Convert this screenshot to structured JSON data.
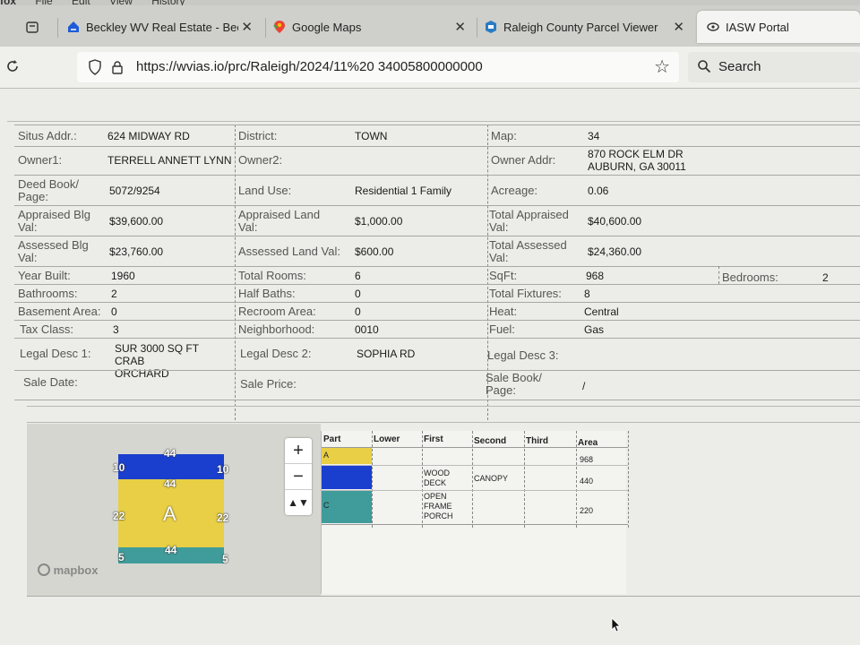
{
  "menu": [
    "fox",
    "File",
    "Edit",
    "View",
    "History"
  ],
  "tabs": [
    {
      "label": "Beckley WV Real Estate - Beckl",
      "icon": "zillow-house-icon",
      "close": "✕"
    },
    {
      "label": "Google Maps",
      "icon": "maps-pin-icon",
      "close": "✕"
    },
    {
      "label": "Raleigh County Parcel Viewer",
      "icon": "parcel-viewer-icon",
      "close": "✕"
    },
    {
      "label": "IASW Portal",
      "icon": "portal-icon",
      "close": ""
    }
  ],
  "nav": {
    "url": "https://wvias.io/prc/Raleigh/2024/11%20 34005800000000",
    "search_label": "Search"
  },
  "parcel": {
    "situs_label": "Situs Addr.:",
    "situs": "624 MIDWAY RD",
    "district_label": "District:",
    "district": "TOWN",
    "map_label": "Map:",
    "map": "34",
    "owner1_label": "Owner1:",
    "owner1": "TERRELL ANNETT LYNN",
    "owner2_label": "Owner2:",
    "owner2": "",
    "owner_addr_label": "Owner Addr:",
    "owner_addr_1": "870 ROCK ELM DR",
    "owner_addr_2": "AUBURN, GA 30011",
    "deed_label": "Deed Book/\nPage:",
    "deed": "5072/9254",
    "land_use_label": "Land Use:",
    "land_use": "Residential 1 Family",
    "acreage_label": "Acreage:",
    "acreage": "0.06",
    "appr_bldg_label": "Appraised Blg\nVal:",
    "appr_bldg": "$39,600.00",
    "appr_land_label": "Appraised Land\nVal:",
    "appr_land": "$1,000.00",
    "total_appr_label": "Total Appraised\nVal:",
    "total_appr": "$40,600.00",
    "assd_bldg_label": "Assessed Blg\nVal:",
    "assd_bldg": "$23,760.00",
    "assd_land_label": "Assessed Land Val:",
    "assd_land": "$600.00",
    "total_assd_label": "Total Assessed\nVal:",
    "total_assd": "$24,360.00",
    "year_label": "Year Built:",
    "year": "1960",
    "rooms_label": "Total Rooms:",
    "rooms": "6",
    "sqft_label": "SqFt:",
    "sqft": "968",
    "bedrooms_label": "Bedrooms:",
    "bedrooms": "2",
    "baths_label": "Bathrooms:",
    "baths": "2",
    "half_label": "Half Baths:",
    "half": "0",
    "fixtures_label": "Total Fixtures:",
    "fixtures": "8",
    "basement_label": "Basement Area:",
    "basement": "0",
    "recroom_label": "Recroom Area:",
    "recroom": "0",
    "heat_label": "Heat:",
    "heat": "Central",
    "taxclass_label": "Tax Class:",
    "taxclass": "3",
    "neighborhood_label": "Neighborhood:",
    "neighborhood": "0010",
    "fuel_label": "Fuel:",
    "fuel": "Gas",
    "legal1_label": "Legal Desc 1:",
    "legal1": "SUR 3000 SQ FT CRAB\nORCHARD",
    "legal2_label": "Legal Desc 2:",
    "legal2": "SOPHIA RD",
    "legal3_label": "Legal Desc 3:",
    "legal3": "",
    "sale_date_label": "Sale Date:",
    "sale_date": "",
    "sale_price_label": "Sale Price:",
    "sale_price": "",
    "sale_book_label": "Sale Book/\nPage:",
    "sale_book": "/"
  },
  "sketch": {
    "dims": {
      "b_top": "44",
      "b_left": "10",
      "b_right": "10",
      "a_top": "44",
      "a_left": "22",
      "a_right": "22",
      "a_bottom": "44",
      "c_left": "5",
      "c_right": "5"
    },
    "center_label": "A",
    "zoom_in": "+",
    "zoom_out": "−",
    "compass": "▲▼",
    "attribution": "mapbox",
    "colors": {
      "a": "#e8cf45",
      "b": "#1a3fcf",
      "c": "#3f9c9a"
    }
  },
  "subareas": {
    "headers": [
      "Part",
      "Lower",
      "First",
      "Second",
      "Third",
      "Area"
    ],
    "rows": [
      {
        "part": "A",
        "lower": "",
        "first": "",
        "second": "",
        "third": "",
        "area": "968"
      },
      {
        "part": "",
        "lower": "",
        "first": "WOOD\nDECK",
        "second": "CANOPY",
        "third": "",
        "area": "440"
      },
      {
        "part": "C",
        "lower": "",
        "first": "OPEN\nFRAME\nPORCH",
        "second": "",
        "third": "",
        "area": "220"
      }
    ]
  }
}
